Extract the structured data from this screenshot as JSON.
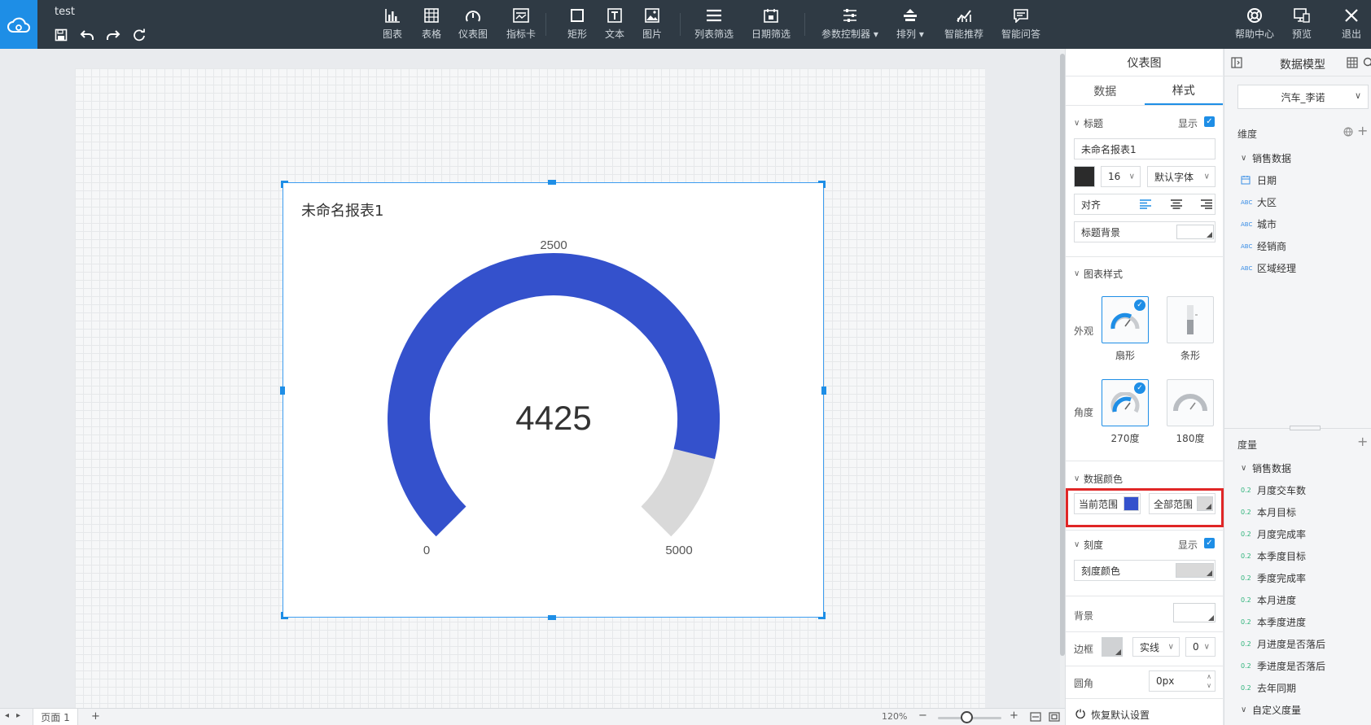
{
  "app": {
    "doc_title": "test"
  },
  "toolbar": {
    "items": [
      {
        "label": "图表",
        "icon": "bar-chart-icon"
      },
      {
        "label": "表格",
        "icon": "table-icon"
      },
      {
        "label": "仪表图",
        "icon": "gauge-icon"
      },
      {
        "label": "指标卡",
        "icon": "kpi-card-icon"
      },
      {
        "label": "矩形",
        "icon": "rectangle-icon"
      },
      {
        "label": "文本",
        "icon": "text-icon"
      },
      {
        "label": "图片",
        "icon": "image-icon"
      },
      {
        "label": "列表筛选",
        "icon": "list-filter-icon"
      },
      {
        "label": "日期筛选",
        "icon": "date-filter-icon"
      },
      {
        "label": "参数控制器",
        "icon": "param-controller-icon"
      },
      {
        "label": "排列",
        "icon": "arrange-icon"
      },
      {
        "label": "智能推荐",
        "icon": "smart-recommend-icon"
      },
      {
        "label": "智能问答",
        "icon": "smart-qa-icon"
      }
    ],
    "right_items": [
      {
        "label": "帮助中心",
        "icon": "help-icon"
      },
      {
        "label": "预览",
        "icon": "preview-icon"
      },
      {
        "label": "退出",
        "icon": "close-icon"
      }
    ]
  },
  "widget": {
    "title": "未命名报表1",
    "gauge": {
      "min": 0,
      "max": 5000,
      "mid_label": "2500",
      "min_label": "0",
      "max_label": "5000",
      "value": 4425,
      "value_text": "4425",
      "angle_degrees": 270,
      "fill_color": "#3451cc",
      "rest_color": "#d9d9d9"
    }
  },
  "bottombar": {
    "page_tab": "页面 1",
    "add_page": "+",
    "zoom": "120%",
    "zoom_level": 0.45,
    "minus": "−",
    "plus": "+"
  },
  "style_panel": {
    "title": "仪表图",
    "tabs": [
      "数据",
      "样式"
    ],
    "active_tab": 1,
    "title_section": {
      "label": "标题",
      "show_label": "显示",
      "title_value": "未命名报表1",
      "font_size": "16",
      "font_family": "默认字体",
      "align_label": "对齐",
      "bg_label": "标题背景",
      "text_color": "#333333"
    },
    "chart_style": {
      "label": "图表样式",
      "appearance_label": "外观",
      "angle_label": "角度",
      "options": {
        "fan": "扇形",
        "bar": "条形",
        "deg270": "270度",
        "deg180": "180度"
      }
    },
    "data_color": {
      "label": "数据颜色",
      "current_range": "当前范围",
      "all_range": "全部范围",
      "current_color": "#3451cc",
      "all_color": "#d9d9d9"
    },
    "scale": {
      "label": "刻度",
      "show_label": "显示",
      "color_label": "刻度颜色"
    },
    "background_label": "背景",
    "border": {
      "label": "边框",
      "style": "实线",
      "width": "0"
    },
    "radius": {
      "label": "圆角",
      "value": "0px"
    },
    "restore": "恢复默认设置"
  },
  "model_panel": {
    "title": "数据模型",
    "dataset": "汽车_李诺",
    "dimension_label": "维度",
    "dimension_group": "销售数据",
    "dimensions": [
      {
        "type": "date",
        "label": "日期"
      },
      {
        "type": "ABC",
        "label": "大区"
      },
      {
        "type": "ABC",
        "label": "城市"
      },
      {
        "type": "ABC",
        "label": "经销商"
      },
      {
        "type": "ABC",
        "label": "区域经理"
      }
    ],
    "measure_label": "度量",
    "measure_group": "销售数据",
    "measures": [
      {
        "type": "0.2",
        "label": "月度交车数"
      },
      {
        "type": "0.2",
        "label": "本月目标"
      },
      {
        "type": "0.2",
        "label": "月度完成率"
      },
      {
        "type": "0.2",
        "label": "本季度目标"
      },
      {
        "type": "0.2",
        "label": "季度完成率"
      },
      {
        "type": "0.2",
        "label": "本月进度"
      },
      {
        "type": "0.2",
        "label": "本季度进度"
      },
      {
        "type": "0.2",
        "label": "月进度是否落后"
      },
      {
        "type": "0.2",
        "label": "季进度是否落后"
      },
      {
        "type": "0.2",
        "label": "去年同期"
      }
    ],
    "custom_measure": "自定义度量"
  }
}
